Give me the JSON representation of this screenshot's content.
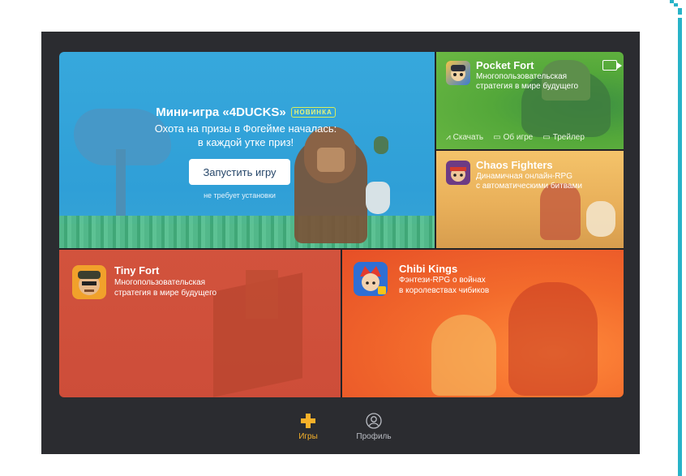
{
  "hero": {
    "title": "Мини-игра «4DUCKS»",
    "badge": "НОВИНКА",
    "subtitle_line1": "Охота на призы в Фогейме началась:",
    "subtitle_line2": "в каждой утке приз!",
    "launch_label": "Запустить игру",
    "note": "не требует установки"
  },
  "tiles": {
    "pocket_fort": {
      "name": "Pocket Fort",
      "desc_line1": "Многопользовательская",
      "desc_line2": "стратегия в мире будущего",
      "actions": {
        "download": "Скачать",
        "about": "Об игре",
        "trailer": "Трейлер"
      }
    },
    "chaos_fighters": {
      "name": "Chaos Fighters",
      "desc_line1": "Динамичная онлайн-RPG",
      "desc_line2": "с автоматическими битвами"
    },
    "tiny_fort": {
      "name": "Tiny Fort",
      "desc_line1": "Многопользовательская",
      "desc_line2": "стратегия в мире будущего"
    },
    "chibi_kings": {
      "name": "Chibi Kings",
      "desc_line1": "Фэнтези-RPG о войнах",
      "desc_line2": "в королевствах чибиков"
    }
  },
  "tabbar": {
    "games": "Игры",
    "profile": "Профиль",
    "active": "games",
    "active_color": "#f6b12a"
  }
}
